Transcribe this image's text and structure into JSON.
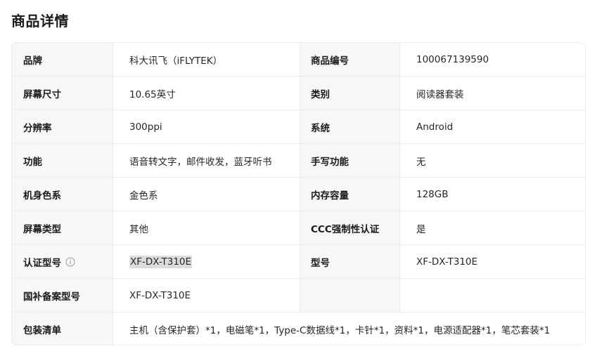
{
  "section_title": "商品详情",
  "rows": [
    {
      "l1": "品牌",
      "v1": "科大讯飞（iFLYTEK）",
      "l2": "商品编号",
      "v2": "100067139590"
    },
    {
      "l1": "屏幕尺寸",
      "v1": "10.65英寸",
      "l2": "类别",
      "v2": "阅读器套装"
    },
    {
      "l1": "分辨率",
      "v1": "300ppi",
      "l2": "系统",
      "v2": "Android"
    },
    {
      "l1": "功能",
      "v1": "语音转文字，邮件收发，蓝牙听书",
      "l2": "手写功能",
      "v2": "无"
    },
    {
      "l1": "机身色系",
      "v1": "金色系",
      "l2": "内存容量",
      "v2": "128GB"
    },
    {
      "l1": "屏幕类型",
      "v1": "其他",
      "l2": "CCC强制性认证",
      "v2": "是"
    },
    {
      "l1": "认证型号",
      "v1": "XF-DX-T310E",
      "l2": "型号",
      "v2": "XF-DX-T310E"
    },
    {
      "l1": "国补备案型号",
      "v1": "XF-DX-T310E",
      "l2": "",
      "v2": ""
    },
    {
      "l1": "包装清单",
      "v1": "主机（含保护套）*1，电磁笔*1，Type-C数据线*1，卡针*1，资料*1，电源适配器*1，笔芯套装*1"
    }
  ]
}
